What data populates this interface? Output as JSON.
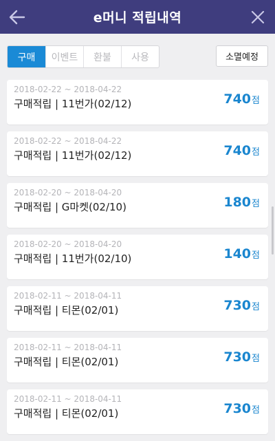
{
  "header": {
    "title": "e머니 적립내역",
    "bg_color": "#3f3d7e"
  },
  "filters": {
    "tabs": [
      {
        "label": "구매",
        "active": true
      },
      {
        "label": "이벤트",
        "active": false
      },
      {
        "label": "환불",
        "active": false
      },
      {
        "label": "사용",
        "active": false
      }
    ],
    "expire_label": "소멸예정",
    "accent_color": "#1a8ad6"
  },
  "records": [
    {
      "period": "2018-02-22 ~ 2018-04-22",
      "description": "구매적립 | 11번가(02/12)",
      "points": "740",
      "unit": "점"
    },
    {
      "period": "2018-02-22 ~ 2018-04-22",
      "description": "구매적립 | 11번가(02/12)",
      "points": "740",
      "unit": "점"
    },
    {
      "period": "2018-02-20 ~ 2018-04-20",
      "description": "구매적립 | G마켓(02/10)",
      "points": "180",
      "unit": "점"
    },
    {
      "period": "2018-02-20 ~ 2018-04-20",
      "description": "구매적립 | 11번가(02/10)",
      "points": "140",
      "unit": "점"
    },
    {
      "period": "2018-02-11 ~ 2018-04-11",
      "description": "구매적립 | 티몬(02/01)",
      "points": "730",
      "unit": "점"
    },
    {
      "period": "2018-02-11 ~ 2018-04-11",
      "description": "구매적립 | 티몬(02/01)",
      "points": "730",
      "unit": "점"
    },
    {
      "period": "2018-02-11 ~ 2018-04-11",
      "description": "구매적립 | 티몬(02/01)",
      "points": "730",
      "unit": "점"
    }
  ]
}
